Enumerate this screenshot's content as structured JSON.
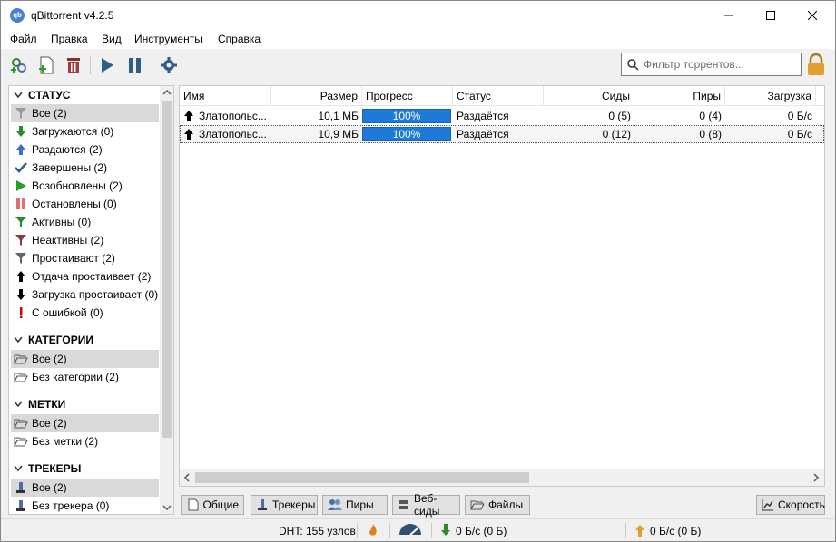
{
  "window": {
    "title": "qBittorrent v4.2.5",
    "app_icon_text": "qb"
  },
  "menu": [
    "Файл",
    "Правка",
    "Вид",
    "Инструменты",
    "Справка"
  ],
  "filter": {
    "placeholder": "Фильтр торрентов..."
  },
  "sidebar": {
    "status_header": "СТАТУС",
    "status_items": [
      "Все (2)",
      "Загружаются (0)",
      "Раздаются (2)",
      "Завершены (2)",
      "Возобновлены (2)",
      "Остановлены (0)",
      "Активны (0)",
      "Неактивны (2)",
      "Простаивают (2)",
      "Отдача простаивает (2)",
      "Загрузка простаивает (0)",
      "С ошибкой (0)"
    ],
    "categories_header": "КАТЕГОРИИ",
    "categories_items": [
      "Все (2)",
      "Без категории (2)"
    ],
    "tags_header": "МЕТКИ",
    "tags_items": [
      "Все (2)",
      "Без метки (2)"
    ],
    "trackers_header": "ТРЕКЕРЫ",
    "trackers_items": [
      "Все (2)",
      "Без трекера (0)"
    ]
  },
  "table": {
    "columns": [
      "Имя",
      "Размер",
      "Прогресс",
      "Статус",
      "Сиды",
      "Пиры",
      "Загрузка"
    ],
    "rows": [
      {
        "name": "Златопольс...",
        "size": "10,1 МБ",
        "progress_label": "100%",
        "progress": 1.0,
        "status": "Раздаётся",
        "seeds": "0 (5)",
        "peers": "0 (4)",
        "download": "0 Б/с"
      },
      {
        "name": "Златопольс...",
        "size": "10,9 МБ",
        "progress_label": "100%",
        "progress": 1.0,
        "status": "Раздаётся",
        "seeds": "0 (12)",
        "peers": "0 (8)",
        "download": "0 Б/с"
      }
    ]
  },
  "tabs": [
    "Общие",
    "Трекеры",
    "Пиры",
    "Веб-сиды",
    "Файлы"
  ],
  "speed_button": "Скорость",
  "statusbar": {
    "dht": "DHT: 155 узлов",
    "download": "0 Б/с (0 Б)",
    "upload": "0 Б/с (0 Б)"
  },
  "colors": {
    "progress": "#1e7ad8",
    "selected": "#d9d9d9",
    "lock": "#e0a030"
  }
}
